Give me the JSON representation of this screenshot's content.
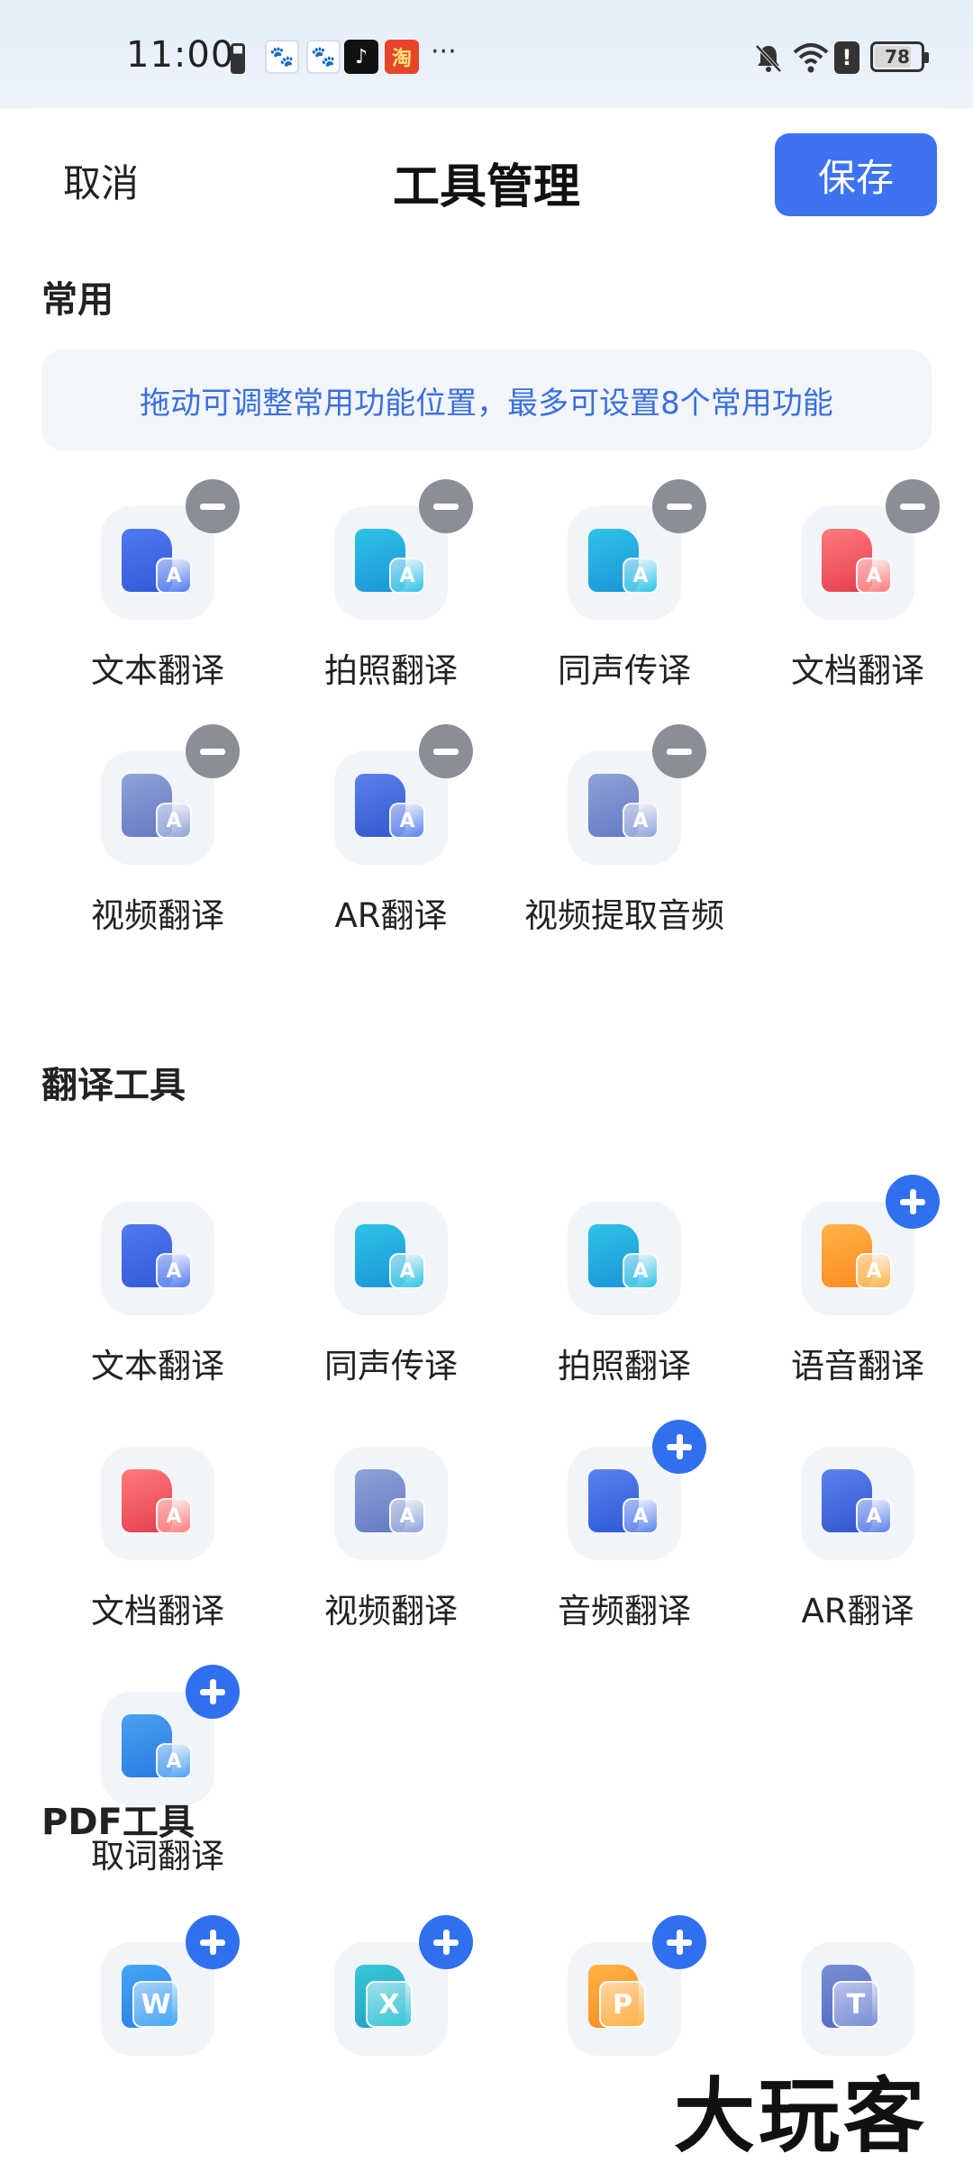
{
  "status_bar": {
    "time": "11:00",
    "battery_level": "78",
    "more": "···",
    "alert": "!",
    "app_icons": [
      "baidu-icon",
      "baidu-icon",
      "tiktok-icon",
      "taobao-icon"
    ]
  },
  "header": {
    "cancel_label": "取消",
    "title": "工具管理",
    "save_label": "保存"
  },
  "common": {
    "title": "常用",
    "hint": "拖动可调整常用功能位置，最多可设置8个常用功能",
    "tools": [
      {
        "label": "文本翻译",
        "icon": "text-translate-icon",
        "badge": "minus"
      },
      {
        "label": "拍照翻译",
        "icon": "photo-translate-icon",
        "badge": "minus"
      },
      {
        "label": "同声传译",
        "icon": "simultaneous-interpretation-icon",
        "badge": "minus"
      },
      {
        "label": "文档翻译",
        "icon": "document-translate-icon",
        "badge": "minus"
      },
      {
        "label": "视频翻译",
        "icon": "video-translate-icon",
        "badge": "minus"
      },
      {
        "label": "AR翻译",
        "icon": "ar-translate-icon",
        "badge": "minus"
      },
      {
        "label": "视频提取音频",
        "icon": "video-extract-audio-icon",
        "badge": "minus"
      }
    ]
  },
  "translate_tools": {
    "title": "翻译工具",
    "tools": [
      {
        "label": "文本翻译",
        "icon": "text-translate-icon",
        "badge": "none"
      },
      {
        "label": "同声传译",
        "icon": "simultaneous-interpretation-icon",
        "badge": "none"
      },
      {
        "label": "拍照翻译",
        "icon": "photo-translate-icon",
        "badge": "none"
      },
      {
        "label": "语音翻译",
        "icon": "voice-translate-icon",
        "badge": "plus"
      },
      {
        "label": "文档翻译",
        "icon": "document-translate-icon",
        "badge": "none"
      },
      {
        "label": "视频翻译",
        "icon": "video-translate-icon",
        "badge": "none"
      },
      {
        "label": "音频翻译",
        "icon": "audio-translate-icon",
        "badge": "plus"
      },
      {
        "label": "AR翻译",
        "icon": "ar-translate-icon",
        "badge": "none"
      },
      {
        "label": "取词翻译",
        "icon": "word-pick-translate-icon",
        "badge": "plus"
      }
    ]
  },
  "pdf_tools": {
    "title": "PDF工具",
    "tools": [
      {
        "icon": "pdf-to-word-icon",
        "badge": "plus",
        "letter": "W"
      },
      {
        "icon": "pdf-to-excel-icon",
        "badge": "plus",
        "letter": "X"
      },
      {
        "icon": "pdf-to-ppt-icon",
        "badge": "plus",
        "letter": "P"
      },
      {
        "icon": "pdf-to-text-icon",
        "badge": "none",
        "letter": "T"
      }
    ]
  },
  "watermark": "大玩客",
  "colors": {
    "accent": "#3d73f0",
    "hint_text": "#3b6fe0",
    "minus_badge": "#8b8e96",
    "plus_badge": "#2f6ff0"
  }
}
